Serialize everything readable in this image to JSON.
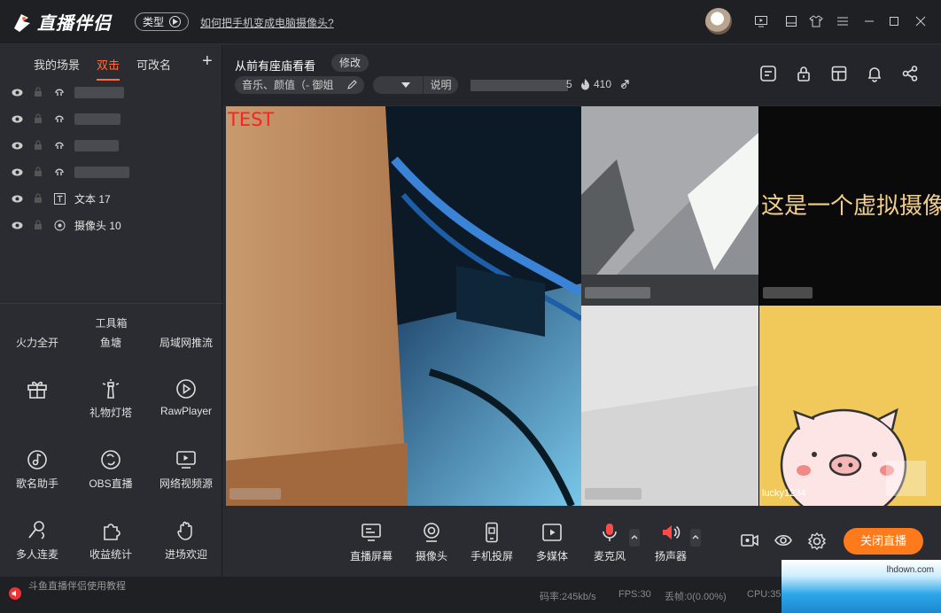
{
  "app": {
    "brand": "直播伴侣",
    "type_button": "类型",
    "help_link": "如何把手机变成电脑摄像头?"
  },
  "scene_tabs": [
    {
      "label": "我的场景",
      "active": false
    },
    {
      "label": "双击",
      "active": true
    },
    {
      "label": "可改名",
      "active": false
    }
  ],
  "sources": [
    {
      "kind": "audio",
      "label": ""
    },
    {
      "kind": "audio",
      "label": ""
    },
    {
      "kind": "audio",
      "label": ""
    },
    {
      "kind": "audio",
      "label": ""
    },
    {
      "kind": "text",
      "label": "文本 17"
    },
    {
      "kind": "camera",
      "label": "摄像头 10"
    }
  ],
  "toolbox": {
    "title": "工具箱",
    "top_row": [
      "火力全开",
      "鱼塘",
      "局域网推流"
    ],
    "items": [
      {
        "label": "",
        "icon": "gift-icon"
      },
      {
        "label": "礼物灯塔",
        "icon": "lighthouse-icon"
      },
      {
        "label": "RawPlayer",
        "icon": "play-circle-icon"
      },
      {
        "label": "歌名助手",
        "icon": "music-note-icon"
      },
      {
        "label": "OBS直播",
        "icon": "obs-icon"
      },
      {
        "label": "网络视频源",
        "icon": "web-video-icon"
      },
      {
        "label": "多人连麦",
        "icon": "multi-mic-icon"
      },
      {
        "label": "收益统计",
        "icon": "puzzle-icon"
      },
      {
        "label": "进场欢迎",
        "icon": "wave-hand-icon"
      }
    ]
  },
  "stage": {
    "scene_title": "从前有座庙看看",
    "edit_label": "修改",
    "category": "音乐、颜值（- 御姐",
    "explain_label": "说明",
    "room_suffix": "5",
    "hot_count": "410"
  },
  "preview": {
    "overlay_text": "TEST",
    "virtual_camera_text": "这是一个虚拟摄像",
    "user_tag": "lucky1234"
  },
  "bottom_buttons": [
    {
      "label": "直播屏幕",
      "icon": "screen-icon"
    },
    {
      "label": "摄像头",
      "icon": "webcam-icon"
    },
    {
      "label": "手机投屏",
      "icon": "phone-cast-icon"
    },
    {
      "label": "多媒体",
      "icon": "media-icon"
    },
    {
      "label": "麦克风",
      "icon": "microphone-icon"
    },
    {
      "label": "扬声器",
      "icon": "speaker-icon"
    }
  ],
  "end_live_label": "关闭直播",
  "status": {
    "tutorial": "斗鱼直播伴侣使用教程",
    "bitrate": "码率:245kb/s",
    "fps": "FPS:30",
    "dropped": "丢帧:0(0.00%)",
    "cpu": "CPU:35"
  },
  "watermark": "lhdown.com",
  "colors": {
    "accent": "#ff6b3d",
    "end_button": "#ff7a1a",
    "mic_red": "#ff4a4a"
  }
}
